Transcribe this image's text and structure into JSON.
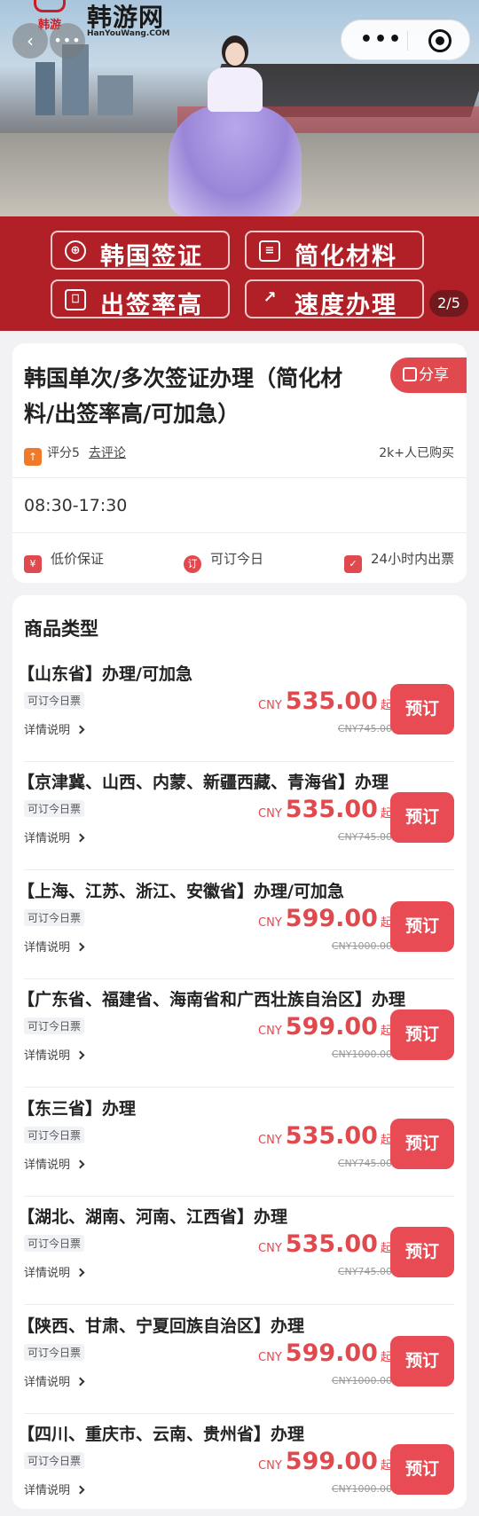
{
  "hero": {
    "logo_mark": "韩游",
    "logo_name": "韩游网",
    "logo_domain": "HanYouWang.COM",
    "back_icon": "chevron-left-icon",
    "more_icon": "more-dots-icon",
    "capsule_more": "•••",
    "tags": [
      {
        "label": "韩国签证",
        "icon": "globe-icon"
      },
      {
        "label": "简化材料",
        "icon": "document-icon"
      },
      {
        "label": "出签率高",
        "icon": "print-icon"
      },
      {
        "label": "速度办理",
        "icon": "rocket-icon"
      }
    ],
    "pager": "2/5",
    "banner_color": "#b22027"
  },
  "info": {
    "title": "韩国单次/多次签证办理（简化材料/出签率高/可加急）",
    "share_label": "分享",
    "rating_text": "评分5",
    "review_link": "去评论",
    "sold": "2k+人已购买",
    "hours": "08:30-17:30",
    "guarantees": [
      {
        "label": "低价保证",
        "icon": "¥"
      },
      {
        "label": "可订今日",
        "icon": "订"
      },
      {
        "label": "24小时内出票",
        "icon": "✓"
      }
    ]
  },
  "products": {
    "section_title": "商品类型",
    "accent_color": "#e04a4f",
    "items": [
      {
        "name": "【山东省】办理/可加急",
        "badge": "可订今日票",
        "detail": "详情说明",
        "currency": "CNY",
        "price": "535.00",
        "qi": "起",
        "original": "CNY745.00",
        "book": "预订"
      },
      {
        "name": "【京津冀、山西、内蒙、新疆西藏、青海省】办理",
        "badge": "可订今日票",
        "detail": "详情说明",
        "currency": "CNY",
        "price": "535.00",
        "qi": "起",
        "original": "CNY745.00",
        "book": "预订"
      },
      {
        "name": "【上海、江苏、浙江、安徽省】办理/可加急",
        "badge": "可订今日票",
        "detail": "详情说明",
        "currency": "CNY",
        "price": "599.00",
        "qi": "起",
        "original": "CNY1000.00",
        "book": "预订"
      },
      {
        "name": "【广东省、福建省、海南省和广西壮族自治区】办理",
        "badge": "可订今日票",
        "detail": "详情说明",
        "currency": "CNY",
        "price": "599.00",
        "qi": "起",
        "original": "CNY1000.00",
        "book": "预订"
      },
      {
        "name": "【东三省】办理",
        "badge": "可订今日票",
        "detail": "详情说明",
        "currency": "CNY",
        "price": "535.00",
        "qi": "起",
        "original": "CNY745.00",
        "book": "预订"
      },
      {
        "name": "【湖北、湖南、河南、江西省】办理",
        "badge": "可订今日票",
        "detail": "详情说明",
        "currency": "CNY",
        "price": "535.00",
        "qi": "起",
        "original": "CNY745.00",
        "book": "预订"
      },
      {
        "name": "【陕西、甘肃、宁夏回族自治区】办理",
        "badge": "可订今日票",
        "detail": "详情说明",
        "currency": "CNY",
        "price": "599.00",
        "qi": "起",
        "original": "CNY1000.00",
        "book": "预订"
      },
      {
        "name": "【四川、重庆市、云南、贵州省】办理",
        "badge": "可订今日票",
        "detail": "详情说明",
        "currency": "CNY",
        "price": "599.00",
        "qi": "起",
        "original": "CNY1000.00",
        "book": "预订"
      }
    ]
  }
}
